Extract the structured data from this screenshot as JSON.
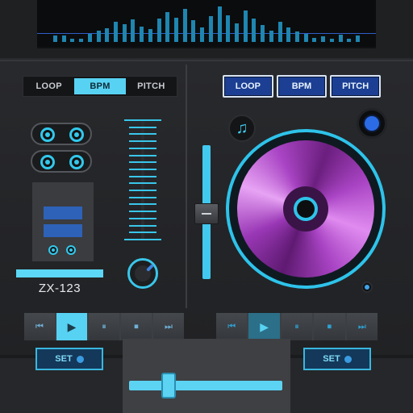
{
  "spectrum": {
    "bars": [
      {
        "h": 0.18
      },
      {
        "h": 0.18
      },
      {
        "h": 0.08
      },
      {
        "h": 0.05
      },
      {
        "h": 0.22
      },
      {
        "h": 0.3
      },
      {
        "h": 0.38
      },
      {
        "h": 0.55
      },
      {
        "h": 0.48
      },
      {
        "h": 0.6
      },
      {
        "h": 0.42
      },
      {
        "h": 0.35
      },
      {
        "h": 0.62
      },
      {
        "h": 0.8
      },
      {
        "h": 0.66
      },
      {
        "h": 0.9
      },
      {
        "h": 0.58
      },
      {
        "h": 0.4
      },
      {
        "h": 0.7
      },
      {
        "h": 0.95
      },
      {
        "h": 0.72
      },
      {
        "h": 0.5
      },
      {
        "h": 0.84
      },
      {
        "h": 0.62
      },
      {
        "h": 0.45
      },
      {
        "h": 0.3
      },
      {
        "h": 0.55
      },
      {
        "h": 0.4
      },
      {
        "h": 0.28
      },
      {
        "h": 0.22
      },
      {
        "h": 0.1
      },
      {
        "h": 0.16
      },
      {
        "h": 0.08
      },
      {
        "h": 0.2
      },
      {
        "h": 0.05
      },
      {
        "h": 0.18
      }
    ]
  },
  "left_deck": {
    "modes": [
      "LOOP",
      "BPM",
      "PITCH"
    ],
    "active_mode": "BPM",
    "deck_name": "ZX-123",
    "pitch_rungs": 18
  },
  "right_deck": {
    "modes": [
      "LOOP",
      "BPM",
      "PITCH"
    ],
    "music_icon": "♫"
  },
  "transport": {
    "icons": [
      "previous-icon",
      "play-icon",
      "pause-icon",
      "stop-icon",
      "next-icon"
    ],
    "glyphs": [
      "⏮",
      "▶",
      "⏸",
      "⏹",
      "⏭"
    ]
  },
  "footer": {
    "set_left": "SET",
    "set_right": "SET"
  },
  "colors": {
    "accent": "#58d2f3",
    "deck_blue": "#1c3f93",
    "platter_purple": "#a944c4"
  }
}
